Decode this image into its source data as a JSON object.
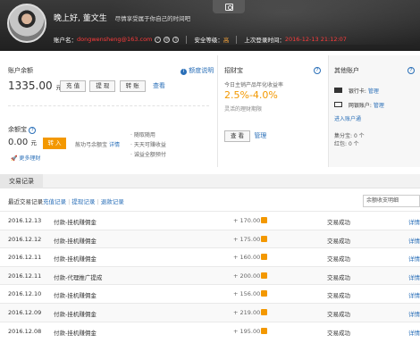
{
  "header": {
    "greeting": "晚上好, 董文生",
    "slogan": "尽情享受属于你自己的时间吧",
    "account_label": "账户名：",
    "account_value": "dongwensheng@163.com",
    "security_label": "安全等级：",
    "security_value": "高",
    "last_login_label": "上次登录时间：",
    "last_login_value": "2016-12-13 21:12:07"
  },
  "balance": {
    "title": "账户余额",
    "info_link": "额度说明",
    "amount": "1335.00",
    "unit": "元",
    "buttons": [
      "充 值",
      "提 现",
      "转 账"
    ],
    "view_link": "查看"
  },
  "yue": {
    "title": "余额宝",
    "amount": "0.00",
    "unit": "元",
    "transfer_button": "转 入",
    "desc": "赦功弓余额宝",
    "detail_link": "详情",
    "features": [
      "随取随用",
      "天天可赚收益",
      "诚益全额预付"
    ],
    "more_link": "更多理财"
  },
  "zhaocai": {
    "title": "招财宝",
    "subtitle": "今日主销产品年化收益率",
    "rate": "2.5%-4.0%",
    "note": "灵活的理财期限",
    "view_button": "查 看",
    "manage_link": "管理"
  },
  "accounts": {
    "title": "其他账户",
    "bank_label": "银行卡:",
    "bank_link": "管理",
    "web_bank_label": "网银账户:",
    "web_bank_link": "管理",
    "transfer_link": "进入账户通",
    "coupon_label": "集分宝:",
    "coupon_value": "0 个",
    "redpack_label": "红包:",
    "redpack_value": "0 个"
  },
  "tabs": {
    "active": "交易记录"
  },
  "filters": {
    "title": "最近交易记录",
    "links": [
      "充值记录",
      "提现记录",
      "退款记录"
    ],
    "search_placeholder": "余额收支明细"
  },
  "transactions": [
    {
      "date": "2016.12.13",
      "desc": "付款-挂机赚佣金",
      "amount": "+ 170.00",
      "status": "交易成功",
      "link": "详情"
    },
    {
      "date": "2016.12.12",
      "desc": "付款-挂机赚佣金",
      "amount": "+ 175.00",
      "status": "交易成功",
      "link": "详情"
    },
    {
      "date": "2016.12.11",
      "desc": "付款-挂机赚佣金",
      "amount": "+ 160.00",
      "status": "交易成功",
      "link": "详情"
    },
    {
      "date": "2016.12.11",
      "desc": "付款-代理推广提成",
      "amount": "+ 200.00",
      "status": "交易成功",
      "link": "详情"
    },
    {
      "date": "2016.12.10",
      "desc": "付款-挂机赚佣金",
      "amount": "+ 156.00",
      "status": "交易成功",
      "link": "详情"
    },
    {
      "date": "2016.12.09",
      "desc": "付款-挂机赚佣金",
      "amount": "+ 219.00",
      "status": "交易成功",
      "link": "详情"
    },
    {
      "date": "2016.12.08",
      "desc": "付款-挂机赚佣金",
      "amount": "+ 195.00",
      "status": "交易成功",
      "link": "详情"
    }
  ]
}
